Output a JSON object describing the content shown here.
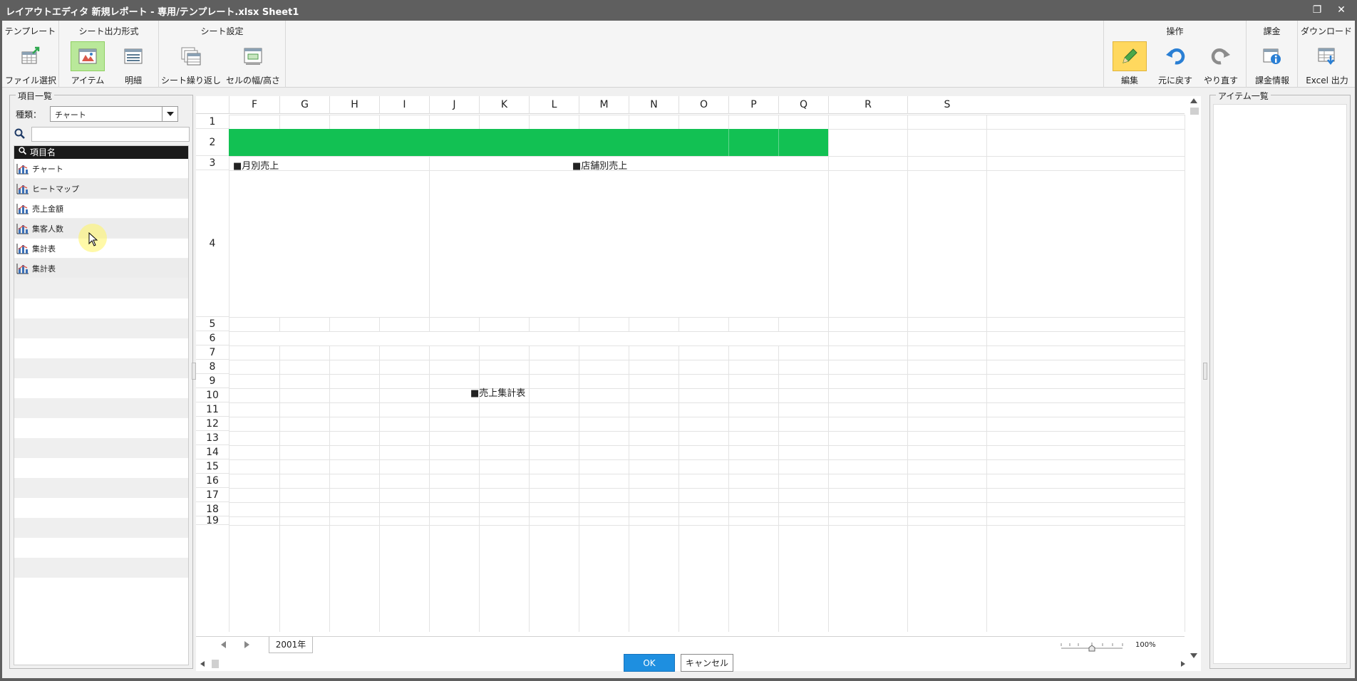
{
  "window": {
    "title": "レイアウトエディタ  新規レポート - 専用/テンプレート.xlsx  Sheet1",
    "restore_glyph": "❐",
    "close_glyph": "✕"
  },
  "ribbon": {
    "groups": {
      "template": "テンプレート",
      "output_format": "シート出力形式",
      "sheet_settings": "シート設定",
      "operations": "操作",
      "billing": "課金",
      "download": "ダウンロード"
    },
    "buttons": {
      "file_select": "ファイル選択",
      "item": "アイテム",
      "detail": "明細",
      "sheet_repeat": "シート繰り返し",
      "cell_size": "セルの幅/高さ",
      "edit": "編集",
      "undo": "元に戻す",
      "redo": "やり直す",
      "billing_info": "課金情報",
      "excel_output": "Excel 出力"
    }
  },
  "left_panel": {
    "title": "項目一覧",
    "kind_label": "種類：",
    "kind_value": "チャート",
    "search_value": "",
    "list_header": "項目名",
    "items": [
      "チャート",
      "ヒートマップ",
      "売上金額",
      "集客人数",
      "集計表",
      "集計表"
    ]
  },
  "sheet": {
    "columns": [
      "F",
      "G",
      "H",
      "I",
      "J",
      "K",
      "L",
      "M",
      "N",
      "O",
      "P",
      "Q",
      "R",
      "S"
    ],
    "rows": [
      "1",
      "2",
      "3",
      "4",
      "5",
      "6",
      "7",
      "8",
      "9",
      "10",
      "11",
      "12",
      "13",
      "14",
      "15",
      "16",
      "17",
      "18",
      "19"
    ],
    "labels": {
      "monthly_sales": "■月別売上",
      "store_sales": "■店舗別売上",
      "sales_summary": "■売上集計表"
    },
    "band_color": "#12c153",
    "tab_name": "2001年",
    "zoom": "100%"
  },
  "right_panel": {
    "title": "アイテム一覧"
  },
  "footer": {
    "ok": "OK",
    "cancel": "キャンセル"
  }
}
